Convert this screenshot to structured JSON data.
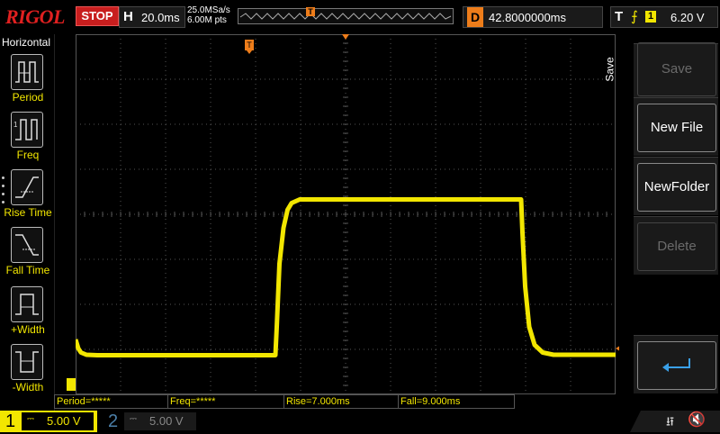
{
  "brand": "RIGOL",
  "run_state": "STOP",
  "horizontal": {
    "label": "H",
    "scale": "20.0ms",
    "sample_rate": "25.0MSa/s",
    "points": "6.00M pts"
  },
  "timeline_marker": "T",
  "delay": {
    "label": "D",
    "value": "42.8000000ms"
  },
  "trigger": {
    "label": "T",
    "edge_icon": "rising-edge-icon",
    "channel": "1",
    "level": "6.20 V"
  },
  "left_menu": {
    "title": "Horizontal",
    "items": [
      {
        "label": "Period",
        "icon": "period-icon"
      },
      {
        "label": "Freq",
        "icon": "freq-icon"
      },
      {
        "label": "Rise Time",
        "icon": "rise-time-icon"
      },
      {
        "label": "Fall Time",
        "icon": "fall-time-icon"
      },
      {
        "label": "+Width",
        "icon": "positive-width-icon"
      },
      {
        "label": "-Width",
        "icon": "negative-width-icon"
      }
    ]
  },
  "right_menu": {
    "tab": "Save",
    "buttons": [
      {
        "label": "Save",
        "enabled": false
      },
      {
        "label": "New File",
        "enabled": true
      },
      {
        "label": "NewFolder",
        "enabled": true
      },
      {
        "label": "Delete",
        "enabled": false
      },
      {
        "label": "",
        "icon": "enter-arrow-icon",
        "enabled": true
      }
    ]
  },
  "measurements": [
    {
      "text": "Period=*****"
    },
    {
      "text": "Freq=*****"
    },
    {
      "text": "Rise=7.000ms"
    },
    {
      "text": "Fall=9.000ms"
    }
  ],
  "channels": [
    {
      "number": "1",
      "scale": "5.00 V",
      "coupling": "DC",
      "active": true
    },
    {
      "number": "2",
      "scale": "5.00 V",
      "coupling": "DC",
      "active": false
    }
  ],
  "colors": {
    "ch1": "#f2e600",
    "accent": "#ee7d1a",
    "stop": "#c81e1e",
    "ch2": "#4b7fa8",
    "grid": "#555555"
  },
  "waveform": {
    "channel": "1",
    "points_div": [
      [
        0,
        1.22
      ],
      [
        0.1,
        1.02
      ],
      [
        0.2,
        0.93
      ],
      [
        0.4,
        0.88
      ],
      [
        0.8,
        0.87
      ],
      [
        7.4,
        0.87
      ],
      [
        7.45,
        1.5
      ],
      [
        7.55,
        2.9
      ],
      [
        7.7,
        3.7
      ],
      [
        7.85,
        4.1
      ],
      [
        8.0,
        4.25
      ],
      [
        8.3,
        4.33
      ],
      [
        16.5,
        4.33
      ],
      [
        16.55,
        3.6
      ],
      [
        16.65,
        2.4
      ],
      [
        16.8,
        1.5
      ],
      [
        17.0,
        1.1
      ],
      [
        17.3,
        0.93
      ],
      [
        17.7,
        0.88
      ],
      [
        20,
        0.88
      ]
    ]
  },
  "status_icons": {
    "usb": "usb-icon",
    "speaker": "speaker-muted-icon"
  }
}
